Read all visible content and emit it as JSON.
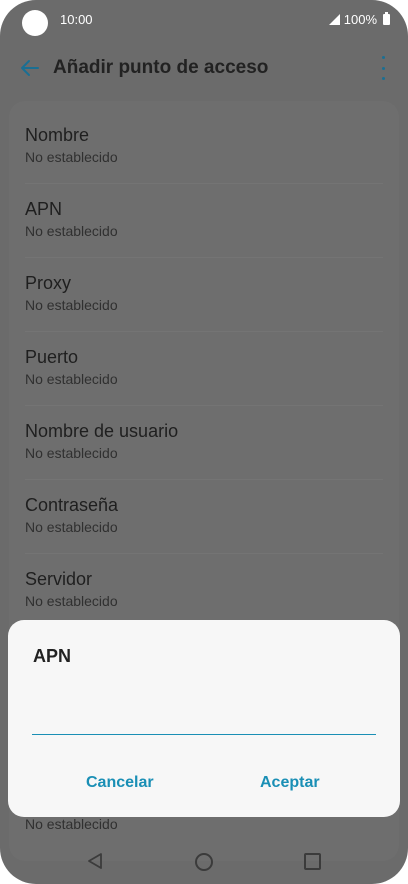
{
  "status_bar": {
    "time": "10:00",
    "battery": "100%"
  },
  "app_bar": {
    "title": "Añadir punto de acceso"
  },
  "list": {
    "items": [
      {
        "label": "Nombre",
        "value": "No establecido"
      },
      {
        "label": "APN",
        "value": "No establecido"
      },
      {
        "label": "Proxy",
        "value": "No establecido"
      },
      {
        "label": "Puerto",
        "value": "No establecido"
      },
      {
        "label": "Nombre de usuario",
        "value": "No establecido"
      },
      {
        "label": "Contraseña",
        "value": "No establecido"
      },
      {
        "label": "Servidor",
        "value": "No establecido"
      }
    ],
    "partial_item_value": "No establecido"
  },
  "dialog": {
    "title": "APN",
    "input_value": "",
    "cancel_label": "Cancelar",
    "accept_label": "Aceptar"
  },
  "icons": {
    "back": "arrow-left-icon",
    "more": "more-vert-icon",
    "nav_back": "triangle-back-icon",
    "nav_home": "circle-home-icon",
    "nav_recent": "square-recent-icon"
  },
  "colors": {
    "accent": "#1a8fb5",
    "dim_background": "#6b6b6b",
    "dialog_background": "#f7f7f7"
  }
}
